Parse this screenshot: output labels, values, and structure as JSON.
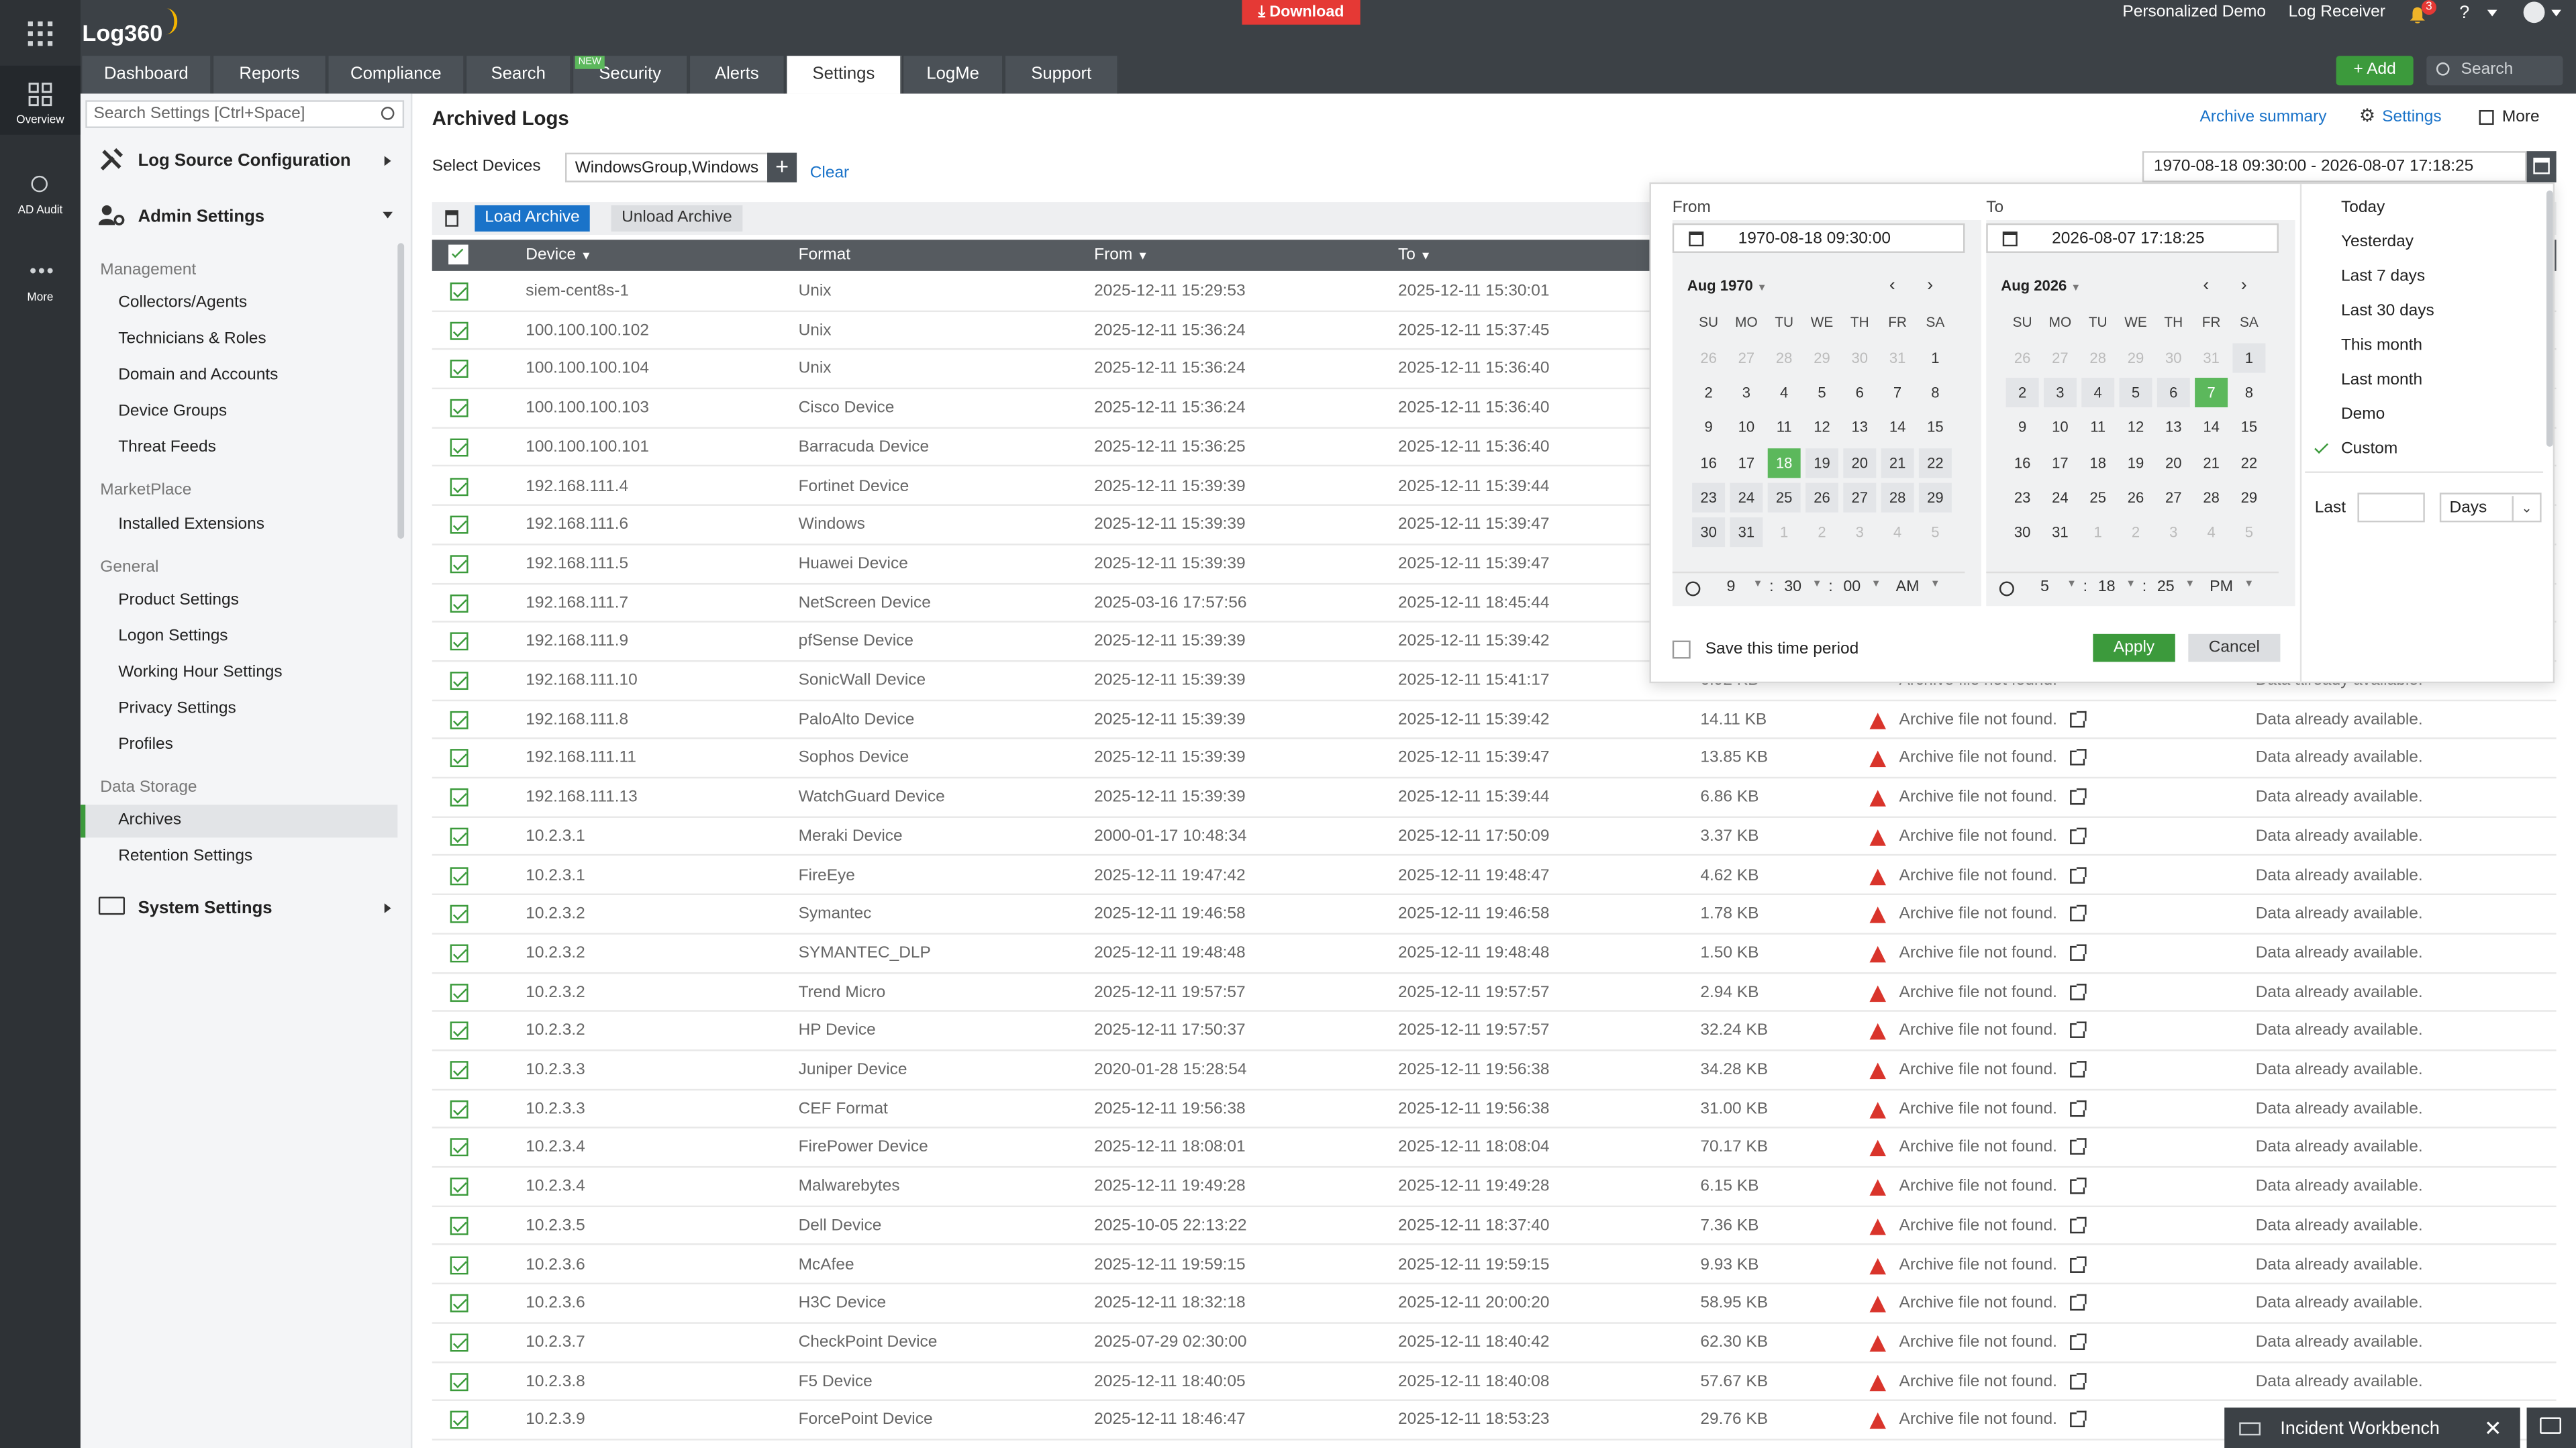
{
  "app": {
    "name": "Log360",
    "download_label": "Download"
  },
  "topbar": {
    "personalized": "Personalized Demo",
    "log_receiver": "Log Receiver",
    "notif_count": "3",
    "help": "?",
    "add_label": "+ Add",
    "search_placeholder": "Search"
  },
  "rail": [
    {
      "label": "Overview"
    },
    {
      "label": "AD Audit"
    },
    {
      "label": "More"
    }
  ],
  "tabs": [
    {
      "label": "Dashboard"
    },
    {
      "label": "Reports"
    },
    {
      "label": "Compliance"
    },
    {
      "label": "Search"
    },
    {
      "label": "Security",
      "badge": "NEW"
    },
    {
      "label": "Alerts"
    },
    {
      "label": "Settings"
    },
    {
      "label": "LogMe"
    },
    {
      "label": "Support"
    }
  ],
  "sidebar": {
    "search_placeholder": "Search Settings [Ctrl+Space]",
    "log_source": "Log Source Configuration",
    "admin": "Admin Settings",
    "management": "Management",
    "management_items": [
      "Collectors/Agents",
      "Technicians & Roles",
      "Domain and Accounts",
      "Device Groups",
      "Threat Feeds"
    ],
    "marketplace": "MarketPlace",
    "marketplace_items": [
      "Installed Extensions"
    ],
    "general": "General",
    "general_items": [
      "Product Settings",
      "Logon Settings",
      "Working Hour Settings",
      "Privacy Settings",
      "Profiles"
    ],
    "data_storage": "Data Storage",
    "data_storage_items": [
      "Archives",
      "Retention Settings"
    ],
    "system": "System Settings"
  },
  "page": {
    "title": "Archived Logs",
    "archive_summary": "Archive summary",
    "settings": "Settings",
    "more": "More",
    "select_devices": "Select Devices",
    "devices_value": "WindowsGroup,Windows",
    "clear": "Clear",
    "range_value": "1970-08-18 09:30:00 - 2026-08-07 17:18:25",
    "load_archive": "Load Archive",
    "unload_archive": "Unload Archive"
  },
  "table": {
    "headers": {
      "device": "Device",
      "format": "Format",
      "from": "From",
      "to": "To"
    },
    "rows": [
      {
        "device": "siem-cent8s-1",
        "format": "Unix",
        "from": "2025-12-11 15:29:53",
        "to": "2025-12-11 15:30:01",
        "size": "",
        "status": "",
        "avail": ""
      },
      {
        "device": "100.100.100.102",
        "format": "Unix",
        "from": "2025-12-11 15:36:24",
        "to": "2025-12-11 15:37:45",
        "size": "",
        "status": "",
        "avail": ""
      },
      {
        "device": "100.100.100.104",
        "format": "Unix",
        "from": "2025-12-11 15:36:24",
        "to": "2025-12-11 15:36:40",
        "size": "",
        "status": "",
        "avail": ""
      },
      {
        "device": "100.100.100.103",
        "format": "Cisco Device",
        "from": "2025-12-11 15:36:24",
        "to": "2025-12-11 15:36:40",
        "size": "",
        "status": "",
        "avail": ""
      },
      {
        "device": "100.100.100.101",
        "format": "Barracuda Device",
        "from": "2025-12-11 15:36:25",
        "to": "2025-12-11 15:36:40",
        "size": "",
        "status": "",
        "avail": ""
      },
      {
        "device": "192.168.111.4",
        "format": "Fortinet Device",
        "from": "2025-12-11 15:39:39",
        "to": "2025-12-11 15:39:44",
        "size": "",
        "status": "",
        "avail": ""
      },
      {
        "device": "192.168.111.6",
        "format": "Windows",
        "from": "2025-12-11 15:39:39",
        "to": "2025-12-11 15:39:47",
        "size": "",
        "status": "",
        "avail": ""
      },
      {
        "device": "192.168.111.5",
        "format": "Huawei Device",
        "from": "2025-12-11 15:39:39",
        "to": "2025-12-11 15:39:47",
        "size": "",
        "status": "",
        "avail": ""
      },
      {
        "device": "192.168.111.7",
        "format": "NetScreen Device",
        "from": "2025-03-16 17:57:56",
        "to": "2025-12-11 18:45:44",
        "size": "",
        "status": "",
        "avail": ""
      },
      {
        "device": "192.168.111.9",
        "format": "pfSense Device",
        "from": "2025-12-11 15:39:39",
        "to": "2025-12-11 15:39:42",
        "size": "",
        "status": "",
        "avail": ""
      },
      {
        "device": "192.168.111.10",
        "format": "SonicWall Device",
        "from": "2025-12-11 15:39:39",
        "to": "2025-12-11 15:41:17",
        "size": "",
        "status": "",
        "avail": ""
      },
      {
        "device": "192.168.111.8",
        "format": "PaloAlto Device",
        "from": "2025-12-11 15:39:39",
        "to": "2025-12-11 15:39:42",
        "size": "14.11 KB",
        "status": "Archive file not found.",
        "avail": "Data already available."
      },
      {
        "device": "192.168.111.11",
        "format": "Sophos Device",
        "from": "2025-12-11 15:39:39",
        "to": "2025-12-11 15:39:47",
        "size": "13.85 KB",
        "status": "Archive file not found.",
        "avail": "Data already available."
      },
      {
        "device": "192.168.111.13",
        "format": "WatchGuard Device",
        "from": "2025-12-11 15:39:39",
        "to": "2025-12-11 15:39:44",
        "size": "6.86 KB",
        "status": "Archive file not found.",
        "avail": "Data already available."
      },
      {
        "device": "10.2.3.1",
        "format": "Meraki Device",
        "from": "2000-01-17 10:48:34",
        "to": "2025-12-11 17:50:09",
        "size": "3.37 KB",
        "status": "Archive file not found.",
        "avail": "Data already available."
      },
      {
        "device": "10.2.3.1",
        "format": "FireEye",
        "from": "2025-12-11 19:47:42",
        "to": "2025-12-11 19:48:47",
        "size": "4.62 KB",
        "status": "Archive file not found.",
        "avail": "Data already available."
      },
      {
        "device": "10.2.3.2",
        "format": "Symantec",
        "from": "2025-12-11 19:46:58",
        "to": "2025-12-11 19:46:58",
        "size": "1.78 KB",
        "status": "Archive file not found.",
        "avail": "Data already available."
      },
      {
        "device": "10.2.3.2",
        "format": "SYMANTEC_DLP",
        "from": "2025-12-11 19:48:48",
        "to": "2025-12-11 19:48:48",
        "size": "1.50 KB",
        "status": "Archive file not found.",
        "avail": "Data already available."
      },
      {
        "device": "10.2.3.2",
        "format": "Trend Micro",
        "from": "2025-12-11 19:57:57",
        "to": "2025-12-11 19:57:57",
        "size": "2.94 KB",
        "status": "Archive file not found.",
        "avail": "Data already available."
      },
      {
        "device": "10.2.3.2",
        "format": "HP Device",
        "from": "2025-12-11 17:50:37",
        "to": "2025-12-11 19:57:57",
        "size": "32.24 KB",
        "status": "Archive file not found.",
        "avail": "Data already available."
      },
      {
        "device": "10.2.3.3",
        "format": "Juniper Device",
        "from": "2020-01-28 15:28:54",
        "to": "2025-12-11 19:56:38",
        "size": "34.28 KB",
        "status": "Archive file not found.",
        "avail": "Data already available."
      },
      {
        "device": "10.2.3.3",
        "format": "CEF Format",
        "from": "2025-12-11 19:56:38",
        "to": "2025-12-11 19:56:38",
        "size": "31.00 KB",
        "status": "Archive file not found.",
        "avail": "Data already available."
      },
      {
        "device": "10.2.3.4",
        "format": "FirePower Device",
        "from": "2025-12-11 18:08:01",
        "to": "2025-12-11 18:08:04",
        "size": "70.17 KB",
        "status": "Archive file not found.",
        "avail": "Data already available."
      },
      {
        "device": "10.2.3.4",
        "format": "Malwarebytes",
        "from": "2025-12-11 19:49:28",
        "to": "2025-12-11 19:49:28",
        "size": "6.15 KB",
        "status": "Archive file not found.",
        "avail": "Data already available."
      },
      {
        "device": "10.2.3.5",
        "format": "Dell Device",
        "from": "2025-10-05 22:13:22",
        "to": "2025-12-11 18:37:40",
        "size": "7.36 KB",
        "status": "Archive file not found.",
        "avail": "Data already available."
      },
      {
        "device": "10.2.3.6",
        "format": "McAfee",
        "from": "2025-12-11 19:59:15",
        "to": "2025-12-11 19:59:15",
        "size": "9.93 KB",
        "status": "Archive file not found.",
        "avail": "Data already available."
      },
      {
        "device": "10.2.3.6",
        "format": "H3C Device",
        "from": "2025-12-11 18:32:18",
        "to": "2025-12-11 20:00:20",
        "size": "58.95 KB",
        "status": "Archive file not found.",
        "avail": "Data already available."
      },
      {
        "device": "10.2.3.7",
        "format": "CheckPoint Device",
        "from": "2025-07-29 02:30:00",
        "to": "2025-12-11 18:40:42",
        "size": "62.30 KB",
        "status": "Archive file not found.",
        "avail": "Data already available."
      },
      {
        "device": "10.2.3.8",
        "format": "F5 Device",
        "from": "2025-12-11 18:40:05",
        "to": "2025-12-11 18:40:08",
        "size": "57.67 KB",
        "status": "Archive file not found.",
        "avail": "Data already available."
      },
      {
        "device": "10.2.3.9",
        "format": "ForcePoint Device",
        "from": "2025-12-11 18:46:47",
        "to": "2025-12-11 18:53:23",
        "size": "29.76 KB",
        "status": "Archive file not found.",
        "avail": "Data already available."
      }
    ]
  },
  "partial_row": {
    "size": "6.92 KB",
    "status": "Archive file not found.",
    "avail": "Data already available."
  },
  "picker": {
    "from_label": "From",
    "to_label": "To",
    "from_value": "1970-08-18 09:30:00",
    "to_value": "2026-08-07 17:18:25",
    "from_month": "Aug 1970",
    "to_month": "Aug 2026",
    "dows": [
      "SU",
      "MO",
      "TU",
      "WE",
      "TH",
      "FR",
      "SA"
    ],
    "from_days": [
      "26",
      "27",
      "28",
      "29",
      "30",
      "31",
      "1",
      "2",
      "3",
      "4",
      "5",
      "6",
      "7",
      "8",
      "9",
      "10",
      "11",
      "12",
      "13",
      "14",
      "15",
      "16",
      "17",
      "18",
      "19",
      "20",
      "21",
      "22",
      "23",
      "24",
      "25",
      "26",
      "27",
      "28",
      "29",
      "30",
      "31",
      "1",
      "2",
      "3",
      "4",
      "5"
    ],
    "to_days": [
      "26",
      "27",
      "28",
      "29",
      "30",
      "31",
      "1",
      "2",
      "3",
      "4",
      "5",
      "6",
      "7",
      "8",
      "9",
      "10",
      "11",
      "12",
      "13",
      "14",
      "15",
      "16",
      "17",
      "18",
      "19",
      "20",
      "21",
      "22",
      "23",
      "24",
      "25",
      "26",
      "27",
      "28",
      "29",
      "30",
      "31",
      "1",
      "2",
      "3",
      "4",
      "5"
    ],
    "from_time": {
      "h": "9",
      "m": "30",
      "s": "00",
      "ampm": "AM"
    },
    "to_time": {
      "h": "5",
      "m": "18",
      "s": "25",
      "ampm": "PM"
    },
    "save_label": "Save this time period",
    "apply": "Apply",
    "cancel": "Cancel",
    "presets": [
      "Today",
      "Yesterday",
      "Last 7 days",
      "Last 30 days",
      "This month",
      "Last month",
      "Demo",
      "Custom"
    ],
    "last_label": "Last",
    "last_unit": "Days"
  },
  "workbench": {
    "label": "Incident Workbench"
  },
  "colors": {
    "accent": "#3c9a3c",
    "topbar": "#3c4146",
    "header": "#565b60",
    "download": "#e53935",
    "link": "#1a73c9"
  }
}
